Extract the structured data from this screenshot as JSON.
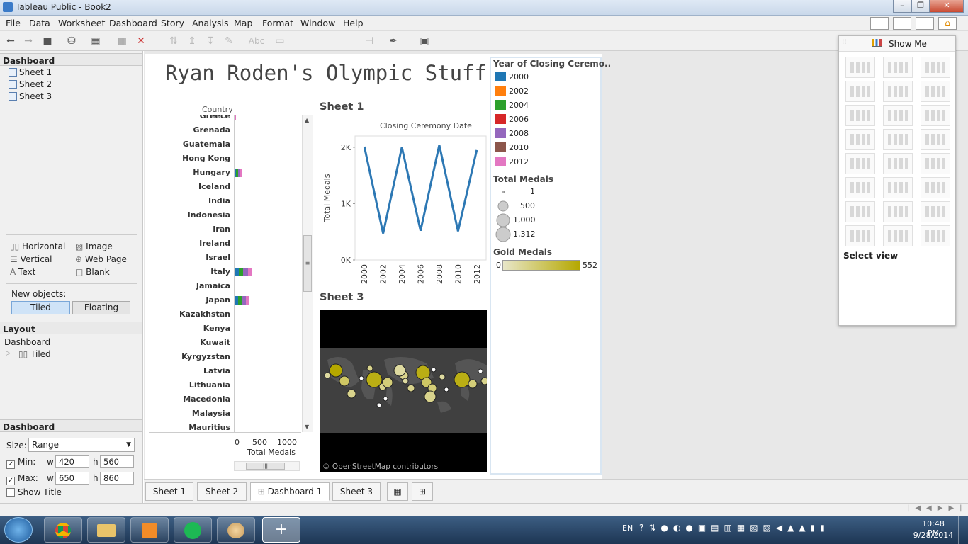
{
  "window_title": "Tableau Public - Book2",
  "menu": [
    "File",
    "Data",
    "Worksheet",
    "Dashboard",
    "Story",
    "Analysis",
    "Map",
    "Format",
    "Window",
    "Help"
  ],
  "toolbar": {
    "abc_label": "Abc"
  },
  "left_panel": {
    "dashboard_header": "Dashboard",
    "sheets": [
      "Sheet 1",
      "Sheet 2",
      "Sheet 3"
    ],
    "objects": {
      "horizontal": "Horizontal",
      "image": "Image",
      "vertical": "Vertical",
      "web_page": "Web Page",
      "text": "Text",
      "blank": "Blank"
    },
    "new_objects_label": "New objects:",
    "tiled_label": "Tiled",
    "floating_label": "Floating",
    "layout_header": "Layout",
    "layout_dashboard": "Dashboard",
    "layout_tiled": "Tiled",
    "size_header": "Dashboard",
    "size_label": "Size:",
    "size_value": "Range",
    "min_label": "Min:",
    "max_label": "Max:",
    "w_label": "w",
    "h_label": "h",
    "min_w": "420",
    "min_h": "560",
    "max_w": "650",
    "max_h": "860",
    "show_title_label": "Show Title"
  },
  "dashboard": {
    "title": "Ryan Roden's Olympic Stuff",
    "country_header": "Country",
    "countries": [
      "Greece",
      "Grenada",
      "Guatemala",
      "Hong Kong",
      "Hungary",
      "Iceland",
      "India",
      "Indonesia",
      "Iran",
      "Ireland",
      "Israel",
      "Italy",
      "Jamaica",
      "Japan",
      "Kazakhstan",
      "Kenya",
      "Kuwait",
      "Kyrgyzstan",
      "Latvia",
      "Lithuania",
      "Macedonia",
      "Malaysia",
      "Mauritius"
    ],
    "medals_axis_title": "Total Medals",
    "medals_ticks": [
      "0",
      "500",
      "1000"
    ],
    "sheet1_title": "Sheet 1",
    "sheet3_title": "Sheet 3",
    "map_credit": "© OpenStreetMap contributors"
  },
  "legend": {
    "year_title": "Year of Closing Ceremo..",
    "years": [
      "2000",
      "2002",
      "2004",
      "2006",
      "2008",
      "2010",
      "2012"
    ],
    "total_medals_title": "Total Medals",
    "size_values": [
      "1",
      "500",
      "1,000",
      "1,312"
    ],
    "gold_title": "Gold Medals",
    "gold_min": "0",
    "gold_max": "552"
  },
  "colors": {
    "2000": "#1f77b4",
    "2002": "#ff7f0e",
    "2004": "#2ca02c",
    "2006": "#d62728",
    "2008": "#9467bd",
    "2010": "#8c564b",
    "2012": "#e377c2",
    "line": "#2d78b4",
    "gold_low": "#e8e6c8",
    "gold_high": "#b5a800"
  },
  "chart_data": [
    {
      "type": "line",
      "title": "Closing Ceremony Date",
      "ylabel": "Total Medals",
      "x": [
        "2000",
        "2002",
        "2004",
        "2006",
        "2008",
        "2010",
        "2012"
      ],
      "values": [
        2010,
        470,
        2000,
        520,
        2040,
        510,
        1950
      ],
      "yticks": [
        "0K",
        "1K",
        "2K"
      ],
      "ylim": [
        0,
        2200
      ]
    },
    {
      "type": "bar",
      "orientation": "horizontal",
      "xlabel": "Total Medals",
      "categories": [
        "Greece",
        "Grenada",
        "Guatemala",
        "Hong Kong",
        "Hungary",
        "Iceland",
        "India",
        "Indonesia",
        "Iran",
        "Ireland",
        "Israel",
        "Italy",
        "Jamaica",
        "Japan",
        "Kazakhstan",
        "Kenya",
        "Kuwait",
        "Kyrgyzstan",
        "Latvia",
        "Lithuania",
        "Macedonia",
        "Malaysia",
        "Mauritius"
      ],
      "values": [
        40,
        2,
        1,
        3,
        150,
        1,
        15,
        20,
        20,
        5,
        1,
        340,
        30,
        290,
        20,
        25,
        1,
        2,
        15,
        15,
        1,
        5,
        1
      ],
      "xlim": [
        0,
        1150
      ]
    }
  ],
  "show_me": {
    "title": "Show Me",
    "select_view": "Select view"
  },
  "bottom_tabs": [
    "Sheet 1",
    "Sheet 2",
    "Dashboard 1",
    "Sheet 3"
  ],
  "taskbar": {
    "lang": "EN",
    "time": "10:48 PM",
    "date": "9/28/2014"
  }
}
